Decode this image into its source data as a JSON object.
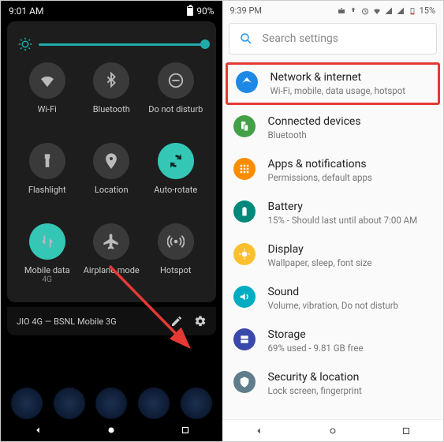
{
  "left": {
    "status": {
      "time": "9:01 AM",
      "battery": "90%"
    },
    "tiles": [
      {
        "name": "wifi",
        "label": "Wi-Fi",
        "on": false
      },
      {
        "name": "bluetooth",
        "label": "Bluetooth",
        "on": false
      },
      {
        "name": "dnd",
        "label": "Do not disturb",
        "on": false
      },
      {
        "name": "flashlight",
        "label": "Flashlight",
        "on": false
      },
      {
        "name": "location",
        "label": "Location",
        "on": false
      },
      {
        "name": "autorotate",
        "label": "Auto-rotate",
        "on": true
      },
      {
        "name": "mobiledata",
        "label": "Mobile data",
        "sub": "4G",
        "on": true
      },
      {
        "name": "airplane",
        "label": "Airplane mode",
        "on": false
      },
      {
        "name": "hotspot",
        "label": "Hotspot",
        "on": false
      }
    ],
    "footer": {
      "network": "JIO 4G — BSNL Mobile 3G"
    }
  },
  "right": {
    "status": {
      "time": "9:39 PM",
      "battery": "15%"
    },
    "search": {
      "placeholder": "Search settings"
    },
    "items": [
      {
        "key": "network",
        "title": "Network & internet",
        "sub": "Wi-Fi, mobile, data usage, hotspot",
        "color": "#1e88e5",
        "highlight": true
      },
      {
        "key": "devices",
        "title": "Connected devices",
        "sub": "Bluetooth",
        "color": "#43a047"
      },
      {
        "key": "apps",
        "title": "Apps & notifications",
        "sub": "Permissions, default apps",
        "color": "#fb8c00"
      },
      {
        "key": "battery",
        "title": "Battery",
        "sub": "15% - Should last until about 7:00 AM",
        "color": "#00897b"
      },
      {
        "key": "display",
        "title": "Display",
        "sub": "Wallpaper, sleep, font size",
        "color": "#fbc02d"
      },
      {
        "key": "sound",
        "title": "Sound",
        "sub": "Volume, vibration, Do not disturb",
        "color": "#00acc1"
      },
      {
        "key": "storage",
        "title": "Storage",
        "sub": "69% used - 9.81 GB free",
        "color": "#3949ab"
      },
      {
        "key": "security",
        "title": "Security & location",
        "sub": "Lock screen, fingerprint",
        "color": "#607d8b"
      }
    ]
  }
}
